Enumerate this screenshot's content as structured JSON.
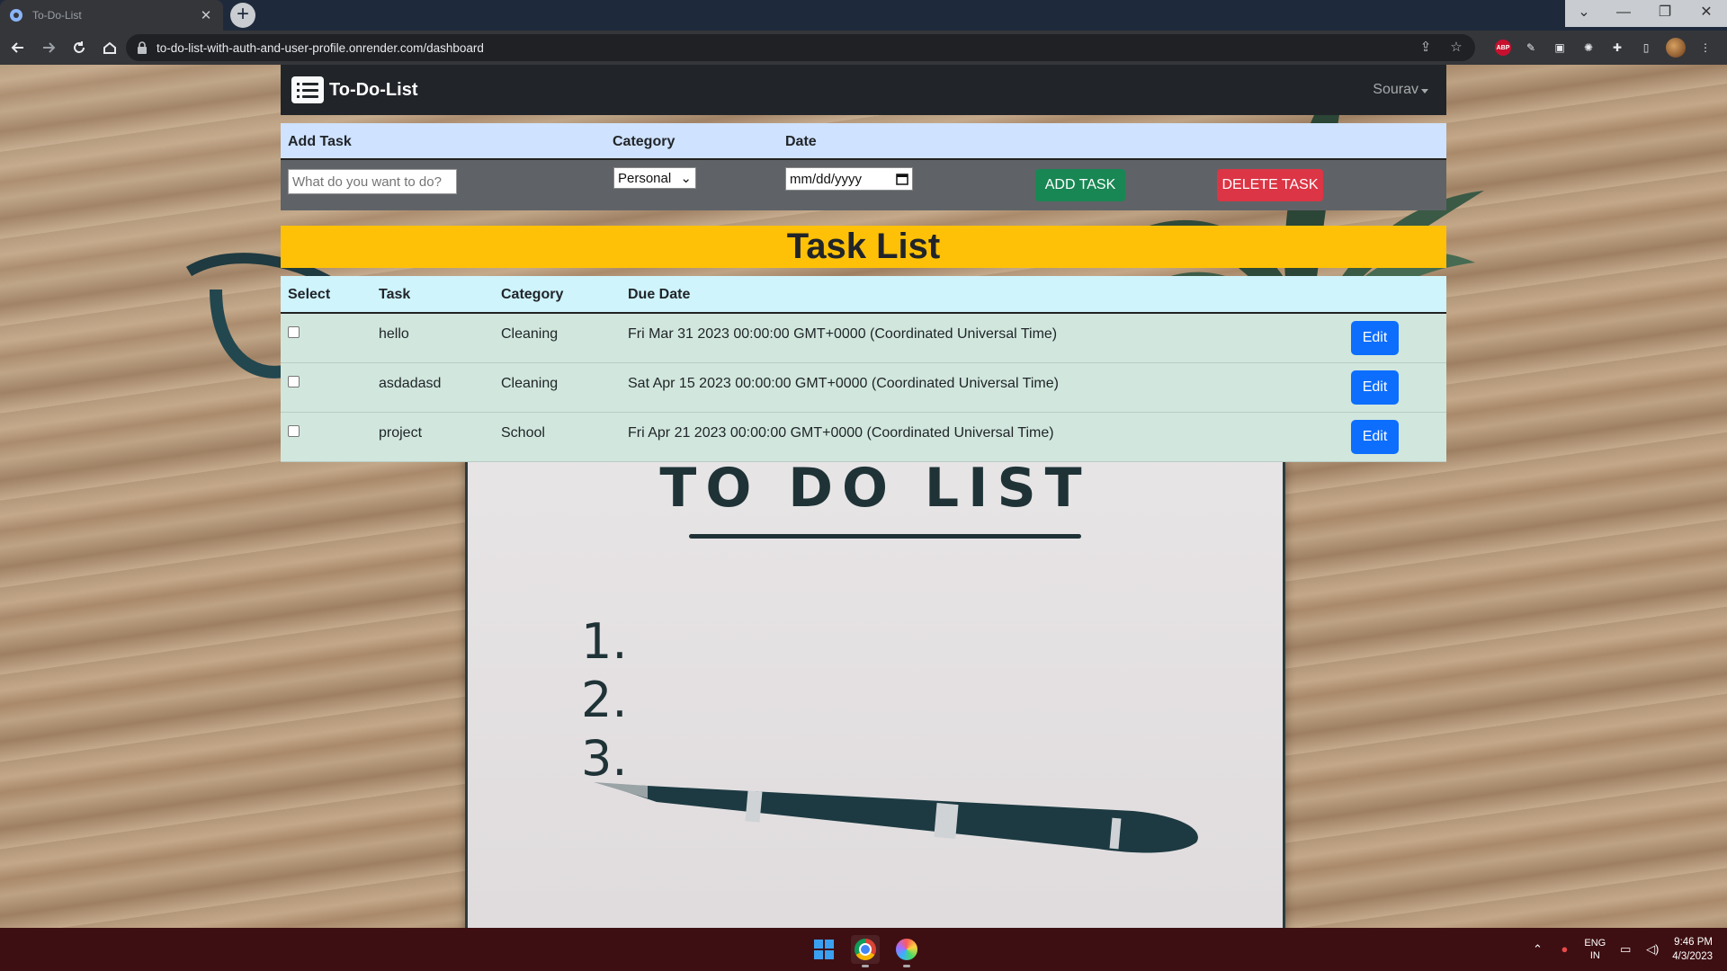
{
  "browser": {
    "tab_title": "To-Do-List",
    "url": "to-do-list-with-auth-and-user-profile.onrender.com/dashboard"
  },
  "navbar": {
    "brand": "To-Do-List",
    "user": "Sourav"
  },
  "add_form": {
    "headers": {
      "task": "Add Task",
      "category": "Category",
      "date": "Date"
    },
    "task_placeholder": "What do you want to do?",
    "category_value": "Personal",
    "date_placeholder": "mm/dd/yyyy",
    "add_label": "ADD TASK",
    "delete_label": "DELETE TASK"
  },
  "task_list": {
    "title": "Task List",
    "headers": {
      "select": "Select",
      "task": "Task",
      "category": "Category",
      "due_date": "Due Date"
    },
    "rows": [
      {
        "task": "hello",
        "category": "Cleaning",
        "due_date": "Fri Mar 31 2023 00:00:00 GMT+0000 (Coordinated Universal Time)",
        "edit": "Edit"
      },
      {
        "task": "asdadasd",
        "category": "Cleaning",
        "due_date": "Sat Apr 15 2023 00:00:00 GMT+0000 (Coordinated Universal Time)",
        "edit": "Edit"
      },
      {
        "task": "project",
        "category": "School",
        "due_date": "Fri Apr 21 2023 00:00:00 GMT+0000 (Coordinated Universal Time)",
        "edit": "Edit"
      }
    ]
  },
  "background_image": {
    "title": "TO DO LIST",
    "numbers": [
      "1.",
      "2.",
      "3."
    ]
  },
  "taskbar": {
    "lang_top": "ENG",
    "lang_bottom": "IN",
    "time": "9:46 PM",
    "date": "4/3/2023"
  },
  "colors": {
    "navbar": "#212529",
    "form_header": "#cfe2ff",
    "add_button": "#198754",
    "delete_button": "#dc3545",
    "banner": "#ffc107",
    "task_header": "#cff4fc",
    "task_row": "#d1e7dd",
    "edit_button": "#0d6efd"
  }
}
